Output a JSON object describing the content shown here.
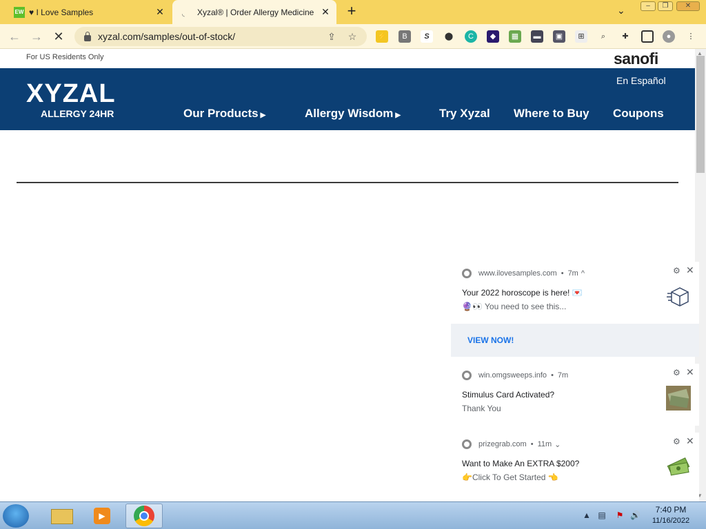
{
  "browser": {
    "tabs": [
      {
        "favicon": "EW",
        "title": "♥ I Love Samples"
      },
      {
        "title": "Xyzal® | Order Allergy Medicine"
      }
    ],
    "url": "xyzal.com/samples/out-of-stock/"
  },
  "site": {
    "residents_note": "For US Residents Only",
    "brand_partner": "sanofi",
    "logo_main": "XYZAL",
    "logo_sub": "ALLERGY 24HR",
    "language_link": "En Español",
    "nav": [
      {
        "label": "Our Products",
        "has_caret": true
      },
      {
        "label": "Allergy Wisdom",
        "has_caret": true
      },
      {
        "label": "Try Xyzal",
        "has_caret": false
      },
      {
        "label": "Where to Buy",
        "has_caret": false
      },
      {
        "label": "Coupons",
        "has_caret": false
      }
    ],
    "header_color": "#0c3f74"
  },
  "notifications": [
    {
      "source": "www.ilovesamples.com",
      "time": "7m",
      "expand": "^",
      "title": "Your 2022 horoscope is here! 💌",
      "body": "🔮👀 You need to see this...",
      "action": "VIEW NOW!",
      "thumb_icon": "box-icon"
    },
    {
      "source": "win.omgsweeps.info",
      "time": "7m",
      "title": "Stimulus Card Activated?",
      "body": "Thank You",
      "thumb_icon": "money-photo-icon"
    },
    {
      "source": "prizegrab.com",
      "time": "11m",
      "expand": "⌄",
      "title": "Want to Make An EXTRA $200?",
      "body": "👉Click To Get Started 👈",
      "thumb_icon": "money-bag-icon"
    }
  ],
  "taskbar": {
    "time": "7:40 PM",
    "date": "11/16/2022"
  }
}
